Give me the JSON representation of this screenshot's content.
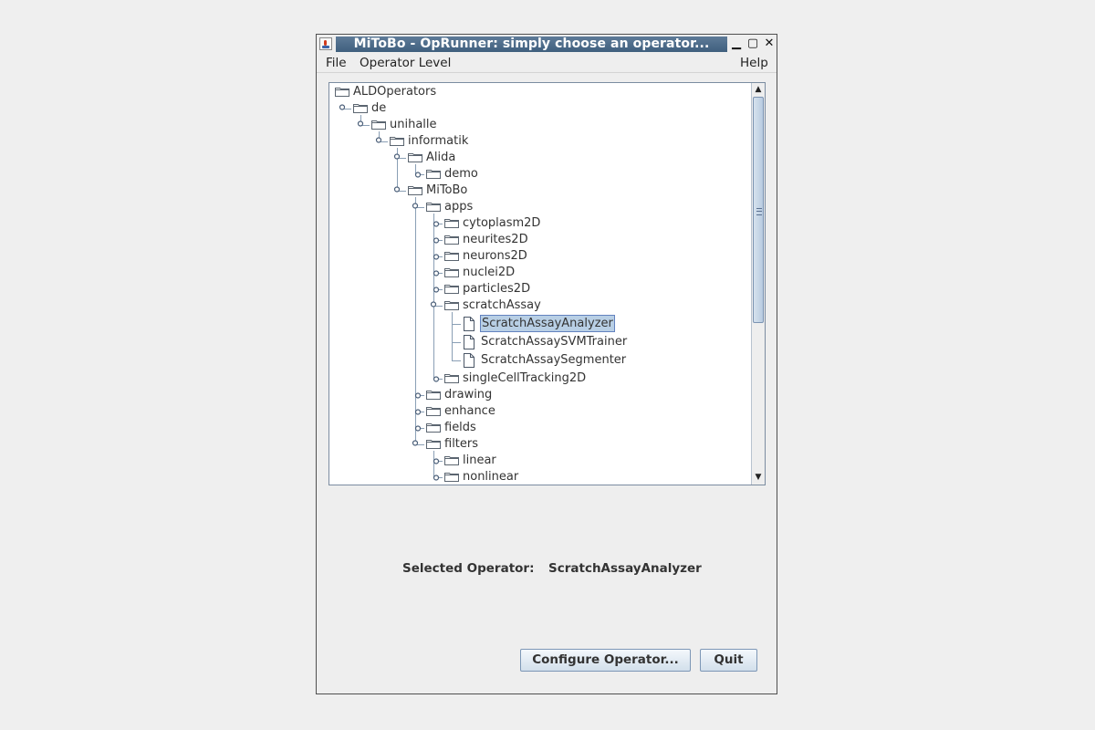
{
  "window": {
    "title": "MiToBo - OpRunner: simply choose an operator...",
    "minimize_glyph": "▁",
    "maximize_glyph": "▢",
    "close_glyph": "✕"
  },
  "menu": {
    "file": "File",
    "operator_level": "Operator Level",
    "help": "Help"
  },
  "tree": {
    "nodes": [
      {
        "label": "ALDOperators",
        "icon": "folder-icon",
        "depth": 0,
        "toggle": "none"
      },
      {
        "label": "de",
        "icon": "folder-icon",
        "depth": 1,
        "toggle": "expanded"
      },
      {
        "label": "unihalle",
        "icon": "folder-icon",
        "depth": 2,
        "toggle": "expanded"
      },
      {
        "label": "informatik",
        "icon": "folder-icon",
        "depth": 3,
        "toggle": "expanded"
      },
      {
        "label": "Alida",
        "icon": "folder-icon",
        "depth": 4,
        "toggle": "expanded"
      },
      {
        "label": "demo",
        "icon": "folder-icon",
        "depth": 5,
        "toggle": "collapsed"
      },
      {
        "label": "MiToBo",
        "icon": "folder-icon",
        "depth": 4,
        "toggle": "expanded"
      },
      {
        "label": "apps",
        "icon": "folder-icon",
        "depth": 5,
        "toggle": "expanded"
      },
      {
        "label": "cytoplasm2D",
        "icon": "folder-icon",
        "depth": 6,
        "toggle": "collapsed"
      },
      {
        "label": "neurites2D",
        "icon": "folder-icon",
        "depth": 6,
        "toggle": "collapsed"
      },
      {
        "label": "neurons2D",
        "icon": "folder-icon",
        "depth": 6,
        "toggle": "collapsed"
      },
      {
        "label": "nuclei2D",
        "icon": "folder-icon",
        "depth": 6,
        "toggle": "collapsed"
      },
      {
        "label": "particles2D",
        "icon": "folder-icon",
        "depth": 6,
        "toggle": "collapsed"
      },
      {
        "label": "scratchAssay",
        "icon": "folder-icon",
        "depth": 6,
        "toggle": "expanded"
      },
      {
        "label": "ScratchAssayAnalyzer",
        "icon": "file-icon",
        "depth": 7,
        "toggle": "none",
        "selected": true
      },
      {
        "label": "ScratchAssaySVMTrainer",
        "icon": "file-icon",
        "depth": 7,
        "toggle": "none"
      },
      {
        "label": "ScratchAssaySegmenter",
        "icon": "file-icon",
        "depth": 7,
        "toggle": "none"
      },
      {
        "label": "singleCellTracking2D",
        "icon": "folder-icon",
        "depth": 6,
        "toggle": "collapsed"
      },
      {
        "label": "drawing",
        "icon": "folder-icon",
        "depth": 5,
        "toggle": "collapsed"
      },
      {
        "label": "enhance",
        "icon": "folder-icon",
        "depth": 5,
        "toggle": "collapsed"
      },
      {
        "label": "fields",
        "icon": "folder-icon",
        "depth": 5,
        "toggle": "collapsed"
      },
      {
        "label": "filters",
        "icon": "folder-icon",
        "depth": 5,
        "toggle": "expanded"
      },
      {
        "label": "linear",
        "icon": "folder-icon",
        "depth": 6,
        "toggle": "collapsed"
      },
      {
        "label": "nonlinear",
        "icon": "folder-icon",
        "depth": 6,
        "toggle": "collapsed"
      }
    ]
  },
  "selection": {
    "caption": "Selected Operator:",
    "value": "ScratchAssayAnalyzer"
  },
  "buttons": {
    "configure": "Configure Operator...",
    "quit": "Quit"
  },
  "colors": {
    "title_bar": "#4f6e8e",
    "selection_bg": "#b8cfe5",
    "tree_line": "#8a9fb5",
    "folder_fill": "#ffffff",
    "folder_stroke": "#5b6570"
  }
}
